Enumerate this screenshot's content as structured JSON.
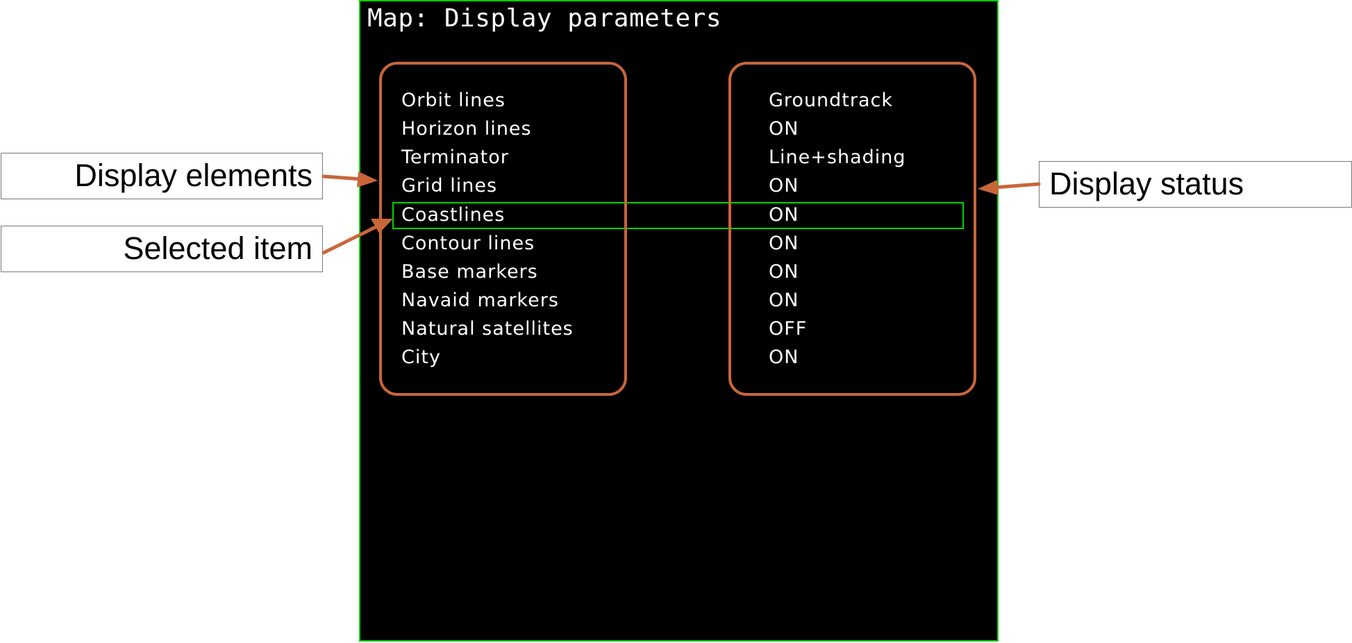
{
  "screen": {
    "title": "Map: Display parameters"
  },
  "parameters": [
    {
      "name": "Orbit lines",
      "value": "Groundtrack"
    },
    {
      "name": "Horizon lines",
      "value": "ON"
    },
    {
      "name": "Terminator",
      "value": "Line+shading"
    },
    {
      "name": "Grid lines",
      "value": "ON"
    },
    {
      "name": "Coastlines",
      "value": "ON"
    },
    {
      "name": "Contour lines",
      "value": "ON"
    },
    {
      "name": "Base markers",
      "value": "ON"
    },
    {
      "name": "Navaid markers",
      "value": "ON"
    },
    {
      "name": "Natural satellites",
      "value": "OFF"
    },
    {
      "name": "City",
      "value": "ON"
    }
  ],
  "selected_index": 4,
  "callouts": {
    "display_elements": "Display elements",
    "selected_item": "Selected item",
    "display_status": "Display status"
  },
  "colors": {
    "screen_border": "#00d400",
    "selection": "#00d400",
    "annotation": "#c8663a",
    "screen_background": "#000000",
    "text": "#ffffff"
  }
}
